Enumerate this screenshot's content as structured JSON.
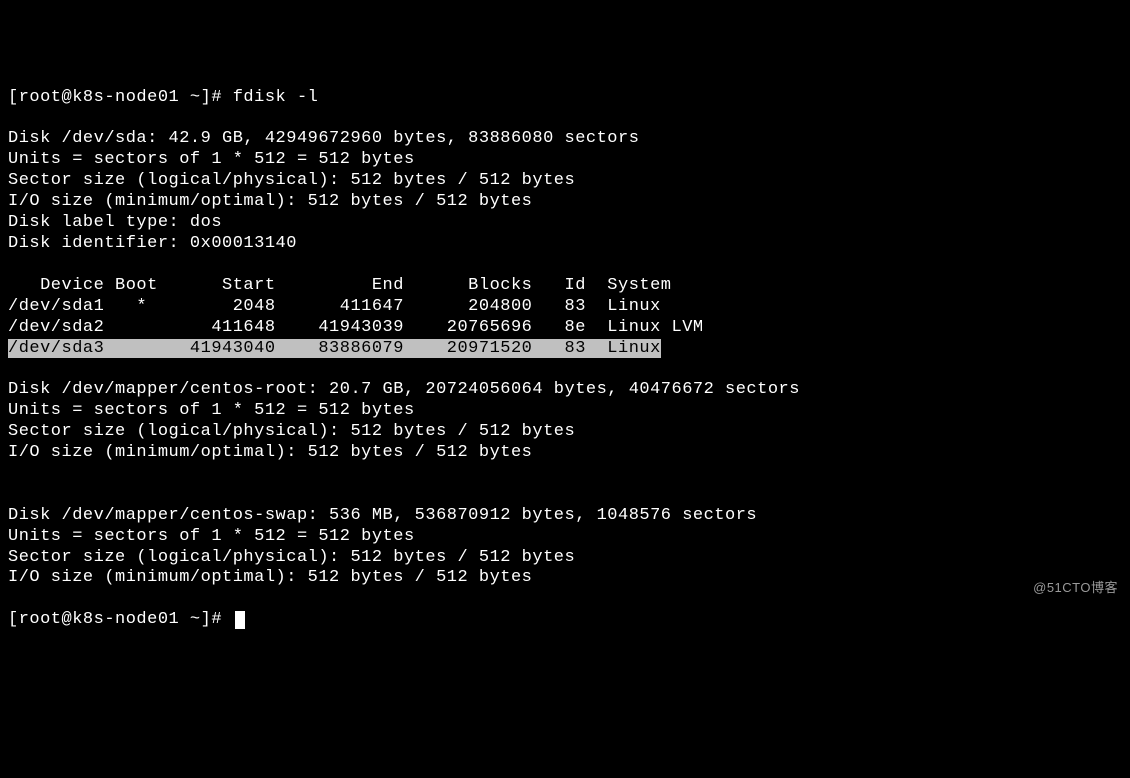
{
  "prompt1": "[root@k8s-node01 ~]# fdisk -l",
  "blank": "",
  "sda": {
    "header": "Disk /dev/sda: 42.9 GB, 42949672960 bytes, 83886080 sectors",
    "units": "Units = sectors of 1 * 512 = 512 bytes",
    "sector": "Sector size (logical/physical): 512 bytes / 512 bytes",
    "io": "I/O size (minimum/optimal): 512 bytes / 512 bytes",
    "labeltype": "Disk label type: dos",
    "identifier": "Disk identifier: 0x00013140"
  },
  "table": {
    "header": "   Device Boot      Start         End      Blocks   Id  System",
    "row1": "/dev/sda1   *        2048      411647      204800   83  Linux",
    "row2": "/dev/sda2          411648    41943039    20765696   8e  Linux LVM",
    "row3": "/dev/sda3        41943040    83886079    20971520   83  Linux"
  },
  "root": {
    "header": "Disk /dev/mapper/centos-root: 20.7 GB, 20724056064 bytes, 40476672 sectors",
    "units": "Units = sectors of 1 * 512 = 512 bytes",
    "sector": "Sector size (logical/physical): 512 bytes / 512 bytes",
    "io": "I/O size (minimum/optimal): 512 bytes / 512 bytes"
  },
  "swap": {
    "header": "Disk /dev/mapper/centos-swap: 536 MB, 536870912 bytes, 1048576 sectors",
    "units": "Units = sectors of 1 * 512 = 512 bytes",
    "sector": "Sector size (logical/physical): 512 bytes / 512 bytes",
    "io": "I/O size (minimum/optimal): 512 bytes / 512 bytes"
  },
  "prompt2": "[root@k8s-node01 ~]# ",
  "watermark": "@51CTO博客"
}
